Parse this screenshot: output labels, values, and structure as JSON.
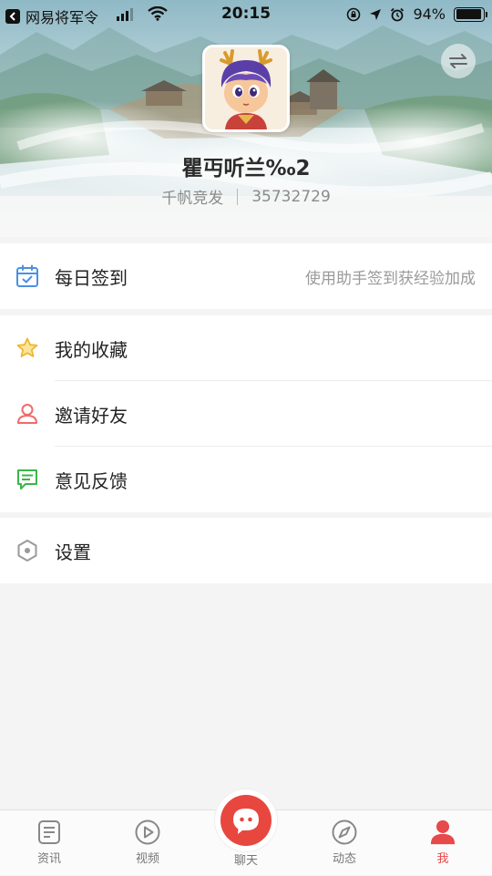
{
  "status_bar": {
    "back_app_name": "网易将军令",
    "time": "20:15",
    "battery_percent": "94%",
    "battery_level": 0.94
  },
  "profile": {
    "username": "瞿丏听兰‰2",
    "server": "千帆竞发",
    "user_id": "35732729"
  },
  "menu": {
    "checkin": {
      "label": "每日签到",
      "hint": "使用助手签到获经验加成",
      "icon": "calendar-check-icon",
      "color": "#4a90e2"
    },
    "items": [
      {
        "label": "我的收藏",
        "icon": "star-icon",
        "color": "#f5c342"
      },
      {
        "label": "邀请好友",
        "icon": "person-icon",
        "color": "#ef6b6b"
      },
      {
        "label": "意见反馈",
        "icon": "message-icon",
        "color": "#3bb54a"
      }
    ],
    "settings": {
      "label": "设置",
      "icon": "hexagon-settings-icon",
      "color": "#9a9a9a"
    }
  },
  "tabs": [
    {
      "label": "资讯",
      "icon": "news-icon",
      "active": false
    },
    {
      "label": "视频",
      "icon": "play-icon",
      "active": false
    },
    {
      "label": "聊天",
      "icon": "chat-icon",
      "active": false
    },
    {
      "label": "动态",
      "icon": "compass-icon",
      "active": false
    },
    {
      "label": "我",
      "icon": "user-icon",
      "active": true
    }
  ],
  "colors": {
    "accent": "#e8473f",
    "background": "#f4f4f4"
  }
}
